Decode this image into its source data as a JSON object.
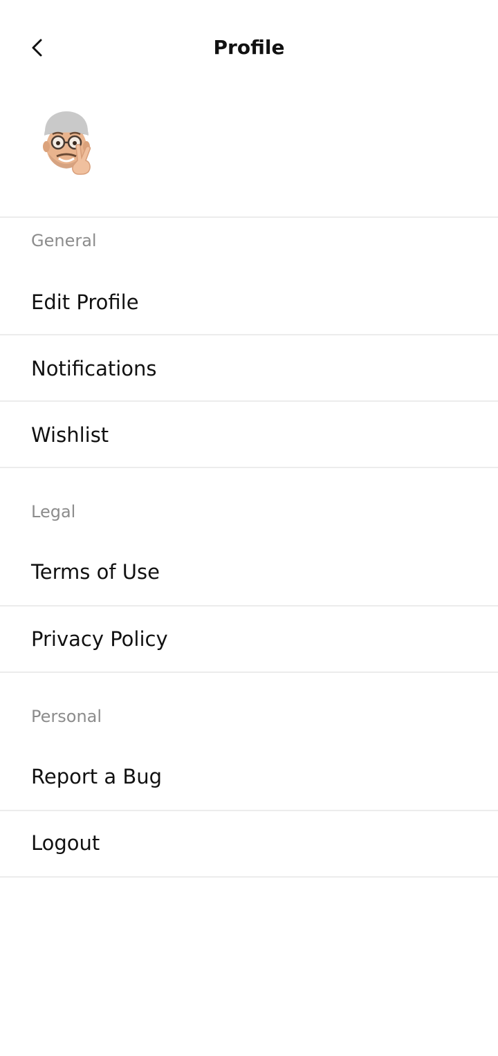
{
  "header": {
    "title": "Profile",
    "back_icon": "chevron-left-icon"
  },
  "avatar": {
    "icon": "memoji-avatar-peace-sign"
  },
  "sections": [
    {
      "label": "General",
      "items": [
        "Edit Profile",
        "Notifications",
        "Wishlist"
      ]
    },
    {
      "label": "Legal",
      "items": [
        "Terms of Use",
        "Privacy Policy"
      ]
    },
    {
      "label": "Personal",
      "items": [
        "Report a Bug",
        "Logout"
      ]
    }
  ],
  "colors": {
    "text_primary": "#111111",
    "text_secondary": "#8c8c8c",
    "divider": "#ececec",
    "background": "#ffffff"
  }
}
